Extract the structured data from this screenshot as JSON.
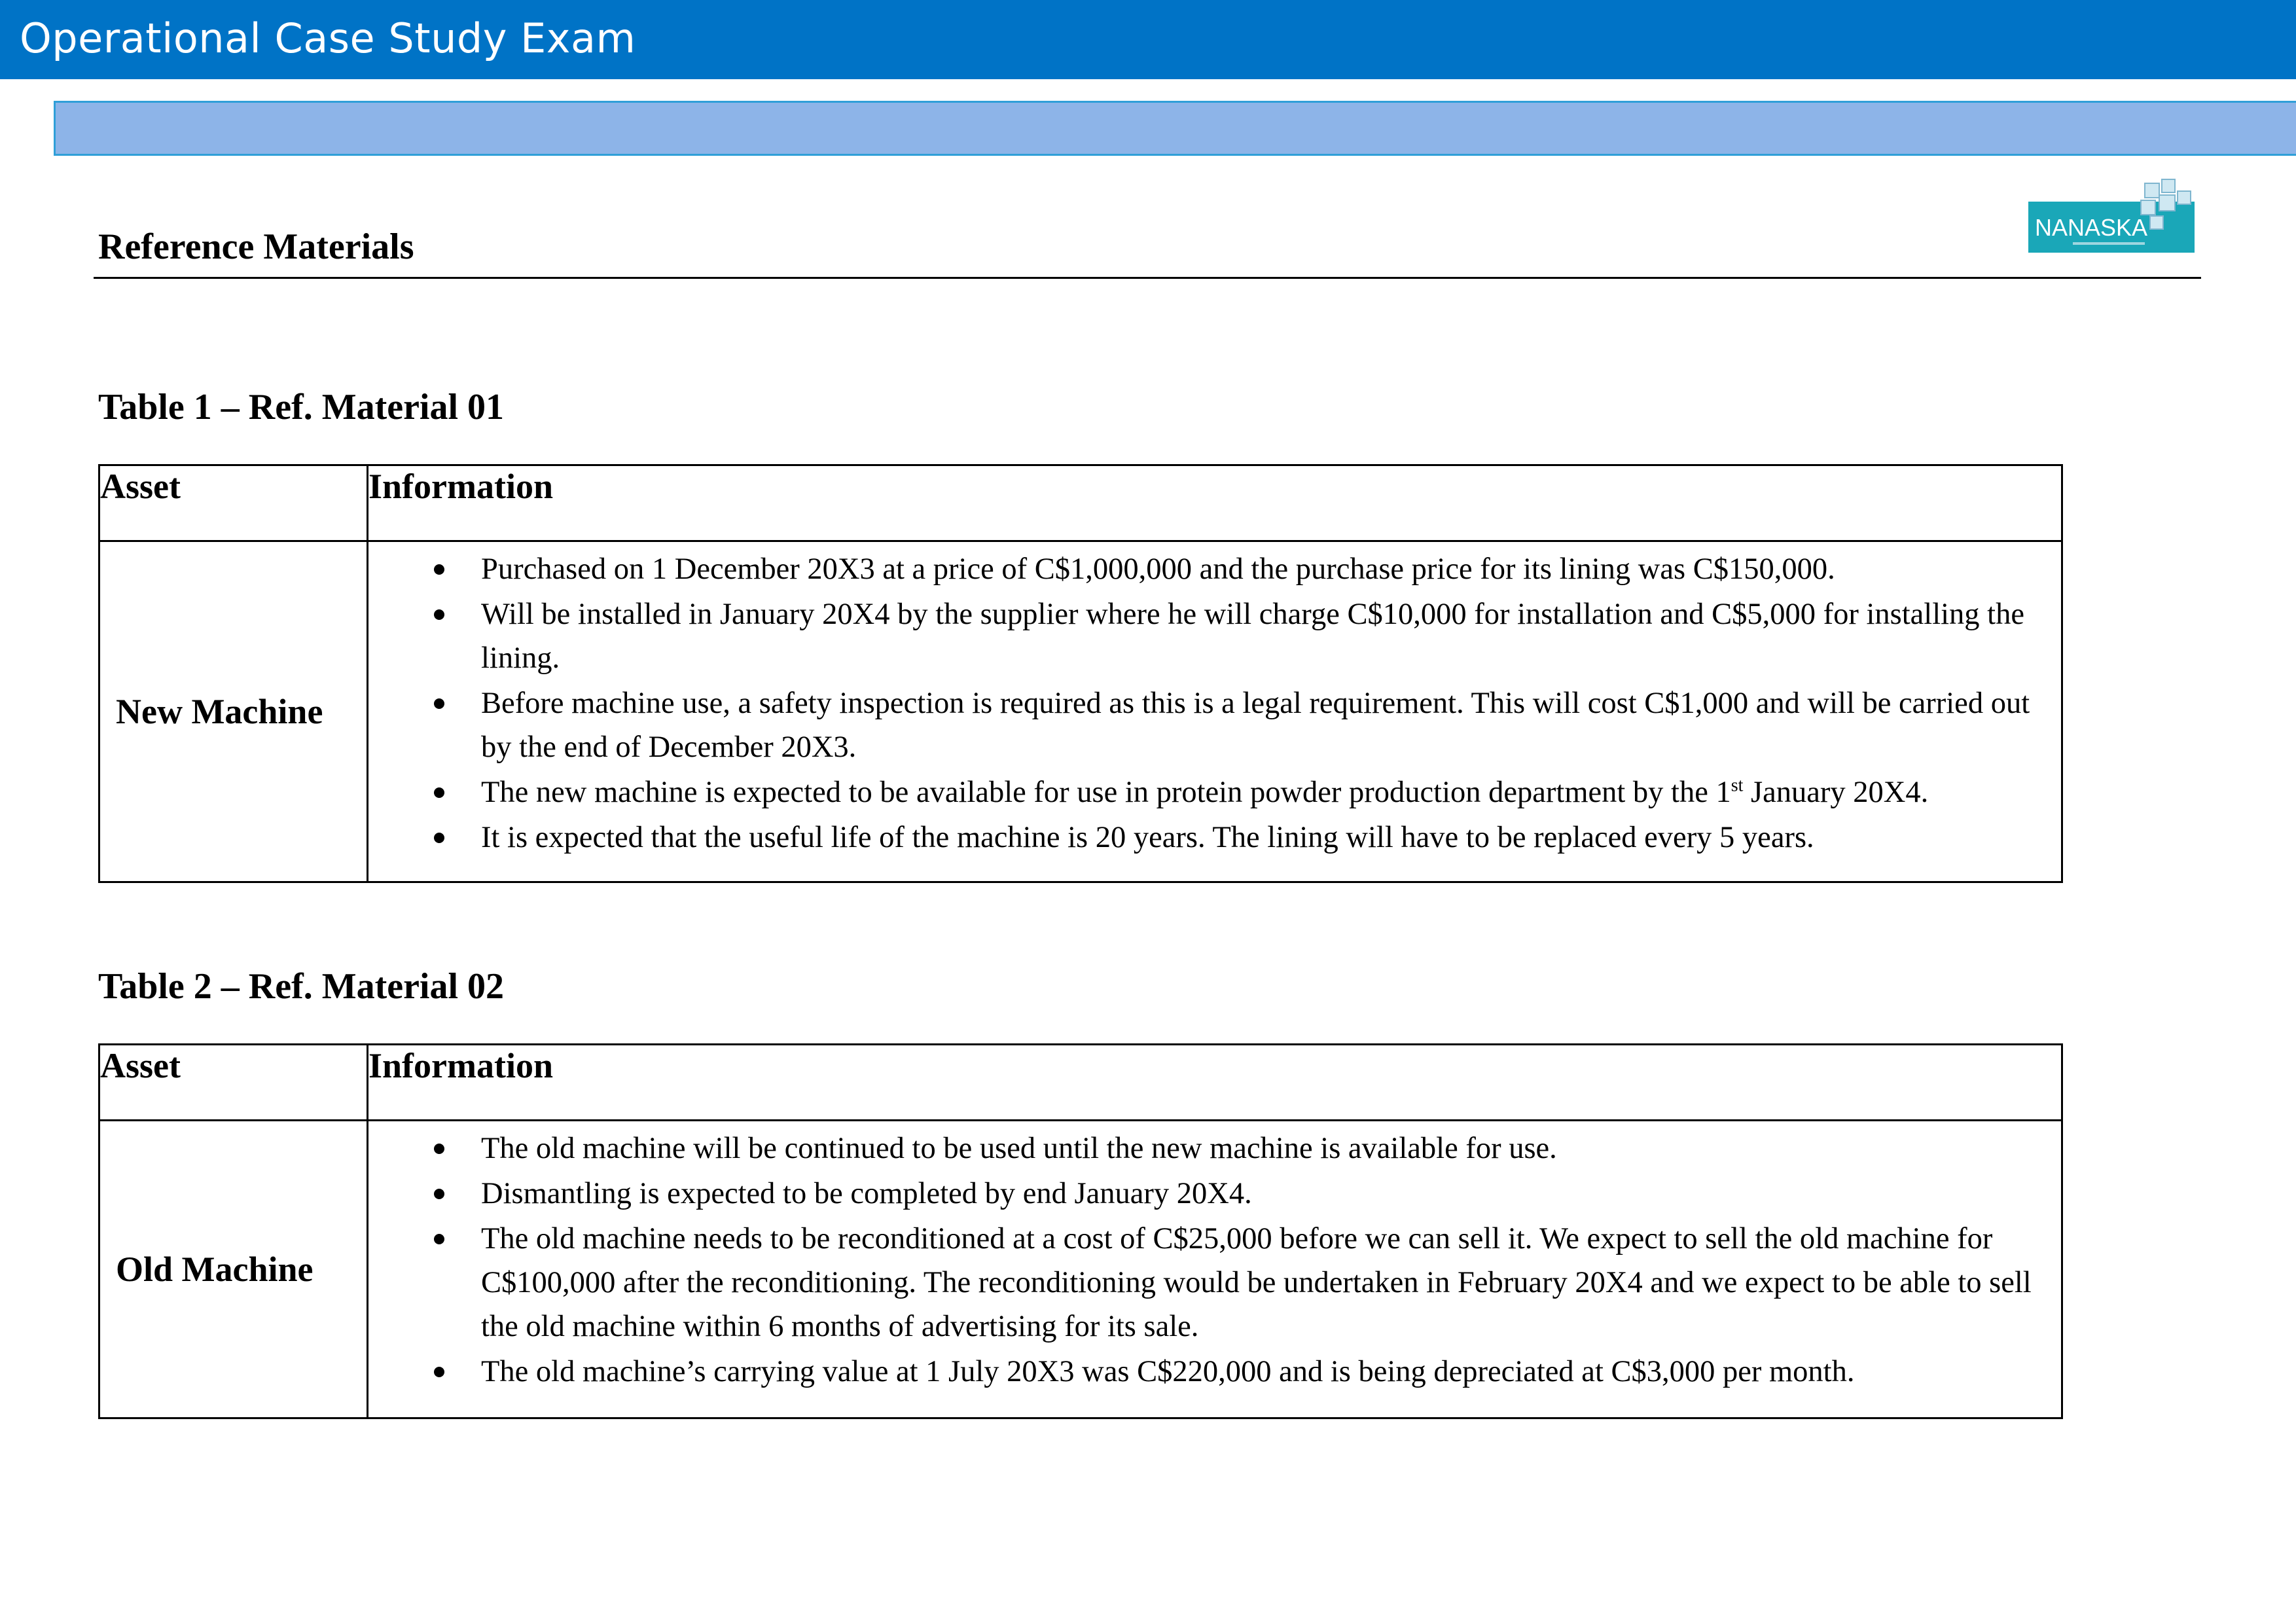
{
  "header": {
    "title": "Operational Case Study Exam"
  },
  "page": {
    "heading": "Reference Materials"
  },
  "logo": {
    "text": "NANASKA",
    "accent_color": "#1aa7b8"
  },
  "tables": [
    {
      "title": "Table 1 – Ref. Material 01",
      "col_asset": "Asset",
      "col_info": "Information",
      "asset": "New Machine",
      "items": [
        "Purchased on 1 December 20X3 at a price of C$1,000,000 and the purchase price for its lining was C$150,000.",
        "Will be installed in January 20X4 by the supplier where he will charge C$10,000 for installation and C$5,000 for installing the lining.",
        "Before machine use, a safety inspection is required as this is a legal requirement. This will cost C$1,000 and will be carried out by the end of December 20X3.",
        {
          "before": "The new machine is expected to be available for use in protein powder production department by the 1",
          "sup": "st",
          "after": " January 20X4."
        },
        "It is expected that the useful life of the machine is 20 years. The lining will have to be replaced every 5 years."
      ]
    },
    {
      "title": "Table 2 – Ref. Material 02",
      "col_asset": "Asset",
      "col_info": "Information",
      "asset": "Old Machine",
      "items": [
        "The old machine will be continued to be used until the new machine is available for use.",
        "Dismantling is expected to be completed by end January 20X4.",
        "The old machine needs to be reconditioned at a cost of C$25,000 before we can sell it. We expect to sell the old machine for C$100,000 after the reconditioning. The reconditioning would be undertaken in February 20X4 and we expect to be able to sell the old machine within 6 months of advertising for its sale.",
        "The old machine’s carrying value at 1 July 20X3 was C$220,000 and is being depreciated at C$3,000 per month."
      ]
    }
  ]
}
